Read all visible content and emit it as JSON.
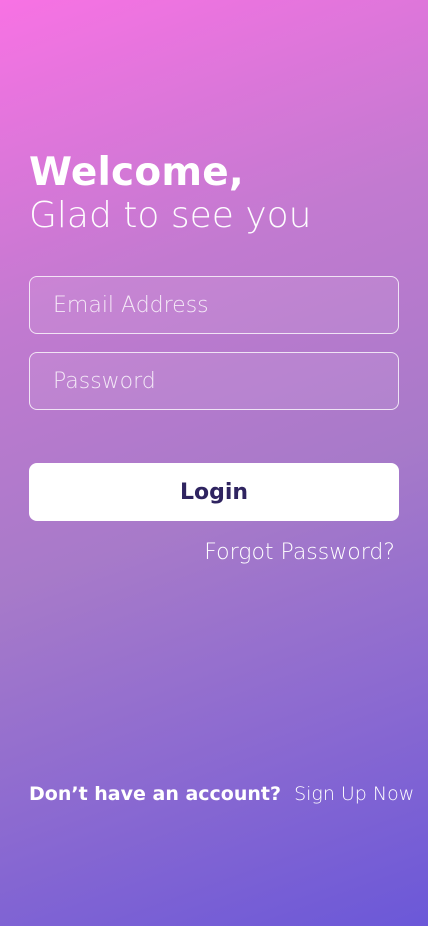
{
  "screen": {
    "title": "Welcome,",
    "subtitle": "Glad to see you"
  },
  "form": {
    "email_placeholder": "Email Address",
    "password_placeholder": "Password",
    "login_label": "Login",
    "forgot_label": "Forgot Password?"
  },
  "footer": {
    "prompt": "Don’t have an account?",
    "signup_label": "Sign Up Now"
  },
  "colors": {
    "gradient_start": "#f872e4",
    "gradient_end": "#6b58d8",
    "button_text": "#2f2460",
    "button_background": "#ffffff"
  }
}
